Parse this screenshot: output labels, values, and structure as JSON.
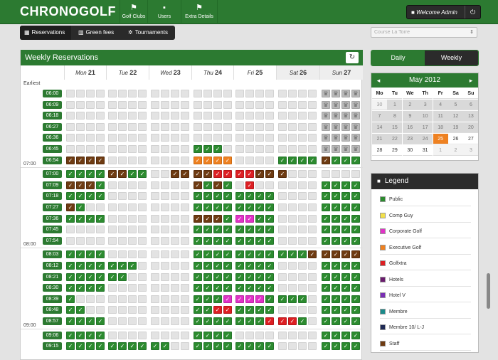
{
  "app": {
    "logo": "CHRONOGOLF",
    "nav": [
      {
        "label": "Golf Clubs",
        "icon": "flag-icon"
      },
      {
        "label": "Users",
        "icon": "user-icon"
      },
      {
        "label": "Extra Details",
        "icon": "flag-icon"
      }
    ],
    "user": "Welcome Admin",
    "power_icon": "power-icon"
  },
  "subnav": {
    "tabs": [
      {
        "label": "Reservations",
        "icon": "calendar-icon",
        "active": true
      },
      {
        "label": "Green fees",
        "icon": "grid-icon",
        "active": false
      },
      {
        "label": "Tournaments",
        "icon": "settings-icon",
        "active": false
      }
    ]
  },
  "club_select": {
    "value": "Course La Torre"
  },
  "panel": {
    "title": "Weekly Reservations",
    "refresh_icon": "refresh-icon",
    "side_labels": [
      "Earliest",
      "07:00",
      "08:00",
      "09:00"
    ],
    "days": [
      {
        "name": "Mon",
        "num": "21",
        "type": "weekday"
      },
      {
        "name": "Tue",
        "num": "22",
        "type": "weekday"
      },
      {
        "name": "Wed",
        "num": "23",
        "type": "weekday"
      },
      {
        "name": "Thu",
        "num": "24",
        "type": "weekday"
      },
      {
        "name": "Fri",
        "num": "25",
        "type": "weekday"
      },
      {
        "name": "Sat",
        "num": "26",
        "type": "sat"
      },
      {
        "name": "Sun",
        "num": "27",
        "type": "sun"
      }
    ],
    "rows": [
      {
        "time": "06:00",
        "sep": "",
        "cells": "........................xxxxxxxxxxxx"
      },
      {
        "time": "06:09",
        "sep": "",
        "cells": "........................xxxxxxxxxxxx"
      },
      {
        "time": "06:18",
        "sep": "",
        "cells": "........................xxxxxxxxxxxx"
      },
      {
        "time": "06:27",
        "sep": "",
        "cells": "........................xxxxxxxxxxxx"
      },
      {
        "time": "06:36",
        "sep": "",
        "cells": "........................xxxxxxxxxxxx"
      },
      {
        "time": "06:45",
        "sep": "",
        "cells": "............ggg.........xxxxxxxxxxxx"
      },
      {
        "time": "06:54",
        "sep": "",
        "cells": "bbbb........oooo....ggggbggg........"
      },
      {
        "time": "07:00",
        "sep": "07:00",
        "cells": "ggggbbgg..bbbbrrrrbbb.........bbbb.."
      },
      {
        "time": "07:09",
        "sep": "",
        "cells": "bbbg........bgbg.r......gggggggg...."
      },
      {
        "time": "07:18",
        "sep": "",
        "cells": "gggg........gggggggg....gggggggg...."
      },
      {
        "time": "07:27",
        "sep": "",
        "cells": "bg..........gggggggg....gggggggg...."
      },
      {
        "time": "07:36",
        "sep": "",
        "cells": "gggg........bbbgmmgg....gggggggg...."
      },
      {
        "time": "07:45",
        "sep": "",
        "cells": "............gggggggg....gggggggg...."
      },
      {
        "time": "07:54",
        "sep": "",
        "cells": "............gggggggg....gggggggg...."
      },
      {
        "time": "08:03",
        "sep": "08:00",
        "cells": "gggg........gggggggggggbbbbbgggg...."
      },
      {
        "time": "08:12",
        "sep": "",
        "cells": "ggggggg.....gggggggg....gggggggg...."
      },
      {
        "time": "08:21",
        "sep": "",
        "cells": "gggggg......gggggggg....gggggggg...."
      },
      {
        "time": "08:30",
        "sep": "",
        "cells": "gggg........gggggggg....gggggggg...."
      },
      {
        "time": "08:39",
        "sep": "",
        "cells": "g...........gggmmmmgggg.gggg........"
      },
      {
        "time": "08:48",
        "sep": "",
        "cells": "gg..........ggrrgggg....gggggggg...."
      },
      {
        "time": "08:57",
        "sep": "",
        "cells": "gggg........gggggggrrrg.gggggggg...."
      },
      {
        "time": "09:06",
        "sep": "09:00",
        "cells": "gggg........gggg........ggggbbbb...."
      },
      {
        "time": "09:15",
        "sep": "",
        "cells": "gggggggggg..gggggggg....gggggggg...."
      }
    ]
  },
  "view_toggle": {
    "daily": "Daily",
    "weekly": "Weekly",
    "active": "weekly"
  },
  "calendar": {
    "month": "May 2012",
    "prev_icon": "chevron-left-icon",
    "next_icon": "chevron-right-icon",
    "headers": [
      "Mo",
      "Tu",
      "We",
      "Th",
      "Fr",
      "Sa",
      "Su"
    ],
    "days": [
      [
        "30",
        "1",
        "2",
        "3",
        "4",
        "5",
        "6"
      ],
      [
        "7",
        "8",
        "9",
        "10",
        "11",
        "12",
        "13"
      ],
      [
        "14",
        "15",
        "16",
        "17",
        "18",
        "19",
        "20"
      ],
      [
        "21",
        "22",
        "23",
        "24",
        "25",
        "26",
        "27"
      ],
      [
        "28",
        "29",
        "30",
        "31",
        "1",
        "2",
        "3"
      ]
    ],
    "today": "25"
  },
  "legend": {
    "title": "Legend",
    "icon": "user-icon",
    "items": [
      {
        "label": "Public",
        "color": "#2c8b2f"
      },
      {
        "label": "Comp Guy",
        "color": "#f2e04a"
      },
      {
        "label": "Corporate Golf",
        "color": "#e033c6"
      },
      {
        "label": "Executive Golf",
        "color": "#ee8121"
      },
      {
        "label": "Golfxtra",
        "color": "#dd1f23"
      },
      {
        "label": "Hotels",
        "color": "#6a1b6e"
      },
      {
        "label": "Hotel V",
        "color": "#7a2fb5"
      },
      {
        "label": "Membre",
        "color": "#1a8a8a"
      },
      {
        "label": "Membre 10/ L-J",
        "color": "#1f2a55"
      },
      {
        "label": "Staff",
        "color": "#6e3b12"
      }
    ]
  }
}
